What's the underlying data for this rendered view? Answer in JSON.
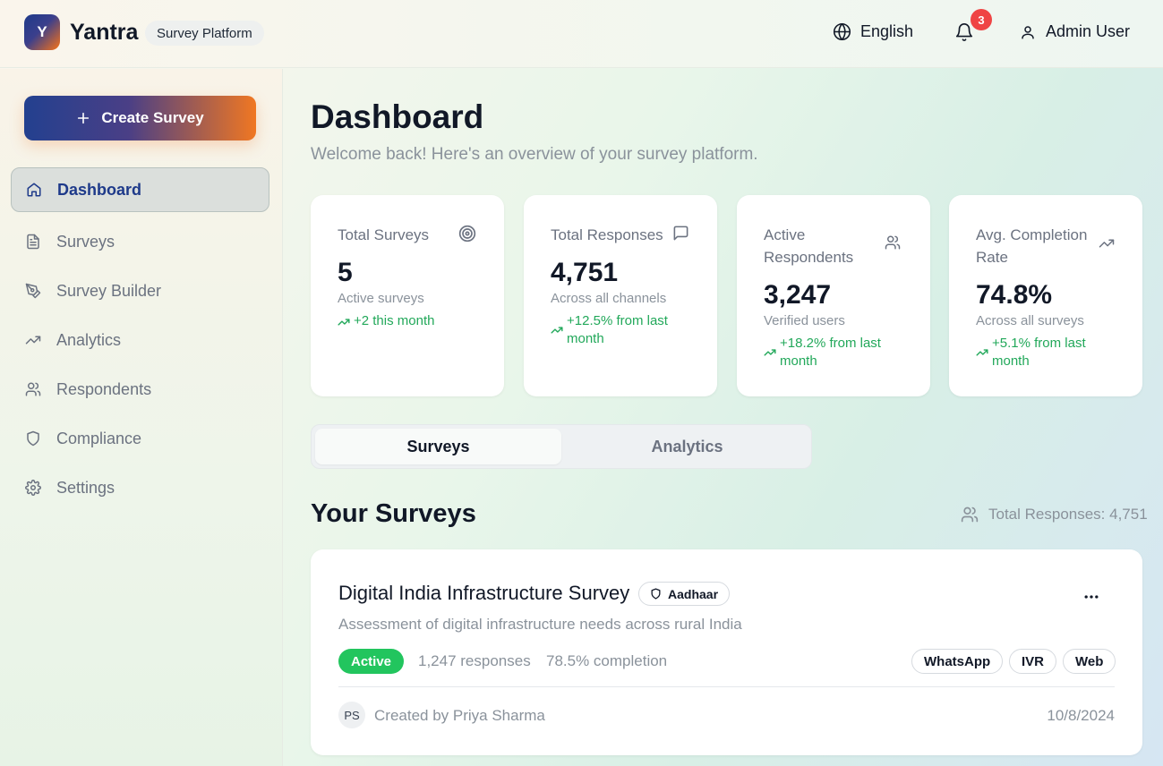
{
  "header": {
    "logo_letter": "Y",
    "brand": "Yantra",
    "platform_chip": "Survey Platform",
    "language": "English",
    "notification_count": "3",
    "user_name": "Admin User"
  },
  "sidebar": {
    "create_button": "Create Survey",
    "items": [
      {
        "label": "Dashboard",
        "icon": "home-icon",
        "active": true
      },
      {
        "label": "Surveys",
        "icon": "file-text-icon",
        "active": false
      },
      {
        "label": "Survey Builder",
        "icon": "pen-tool-icon",
        "active": false
      },
      {
        "label": "Analytics",
        "icon": "trending-up-icon",
        "active": false
      },
      {
        "label": "Respondents",
        "icon": "users-icon",
        "active": false
      },
      {
        "label": "Compliance",
        "icon": "shield-icon",
        "active": false
      },
      {
        "label": "Settings",
        "icon": "gear-icon",
        "active": false
      }
    ]
  },
  "main": {
    "title": "Dashboard",
    "subtitle": "Welcome back! Here's an overview of your survey platform.",
    "stats": [
      {
        "label": "Total Surveys",
        "value": "5",
        "desc": "Active surveys",
        "trend": "+2 this month",
        "icon": "target-icon"
      },
      {
        "label": "Total Responses",
        "value": "4,751",
        "desc": "Across all channels",
        "trend": "+12.5% from last month",
        "icon": "message-square-icon"
      },
      {
        "label": "Active Respondents",
        "value": "3,247",
        "desc": "Verified users",
        "trend": "+18.2% from last month",
        "icon": "users-icon"
      },
      {
        "label": "Avg. Completion Rate",
        "value": "74.8%",
        "desc": "Across all surveys",
        "trend": "+5.1% from last month",
        "icon": "trending-up-icon"
      }
    ],
    "tabs": [
      {
        "label": "Surveys",
        "active": true
      },
      {
        "label": "Analytics",
        "active": false
      }
    ],
    "section_title": "Your Surveys",
    "total_responses": "Total Responses: 4,751",
    "surveys": [
      {
        "title": "Digital India Infrastructure Survey",
        "verification": "Aadhaar",
        "description": "Assessment of digital infrastructure needs across rural India",
        "status": "Active",
        "responses": "1,247 responses",
        "completion": "78.5% completion",
        "channels": [
          "WhatsApp",
          "IVR",
          "Web"
        ],
        "creator_initials": "PS",
        "created_by": "Created by Priya Sharma",
        "date": "10/8/2024"
      }
    ]
  },
  "colors": {
    "primary": "#1e3a8a",
    "accent": "#f07722",
    "success": "#22c55e",
    "danger": "#ef4444"
  }
}
